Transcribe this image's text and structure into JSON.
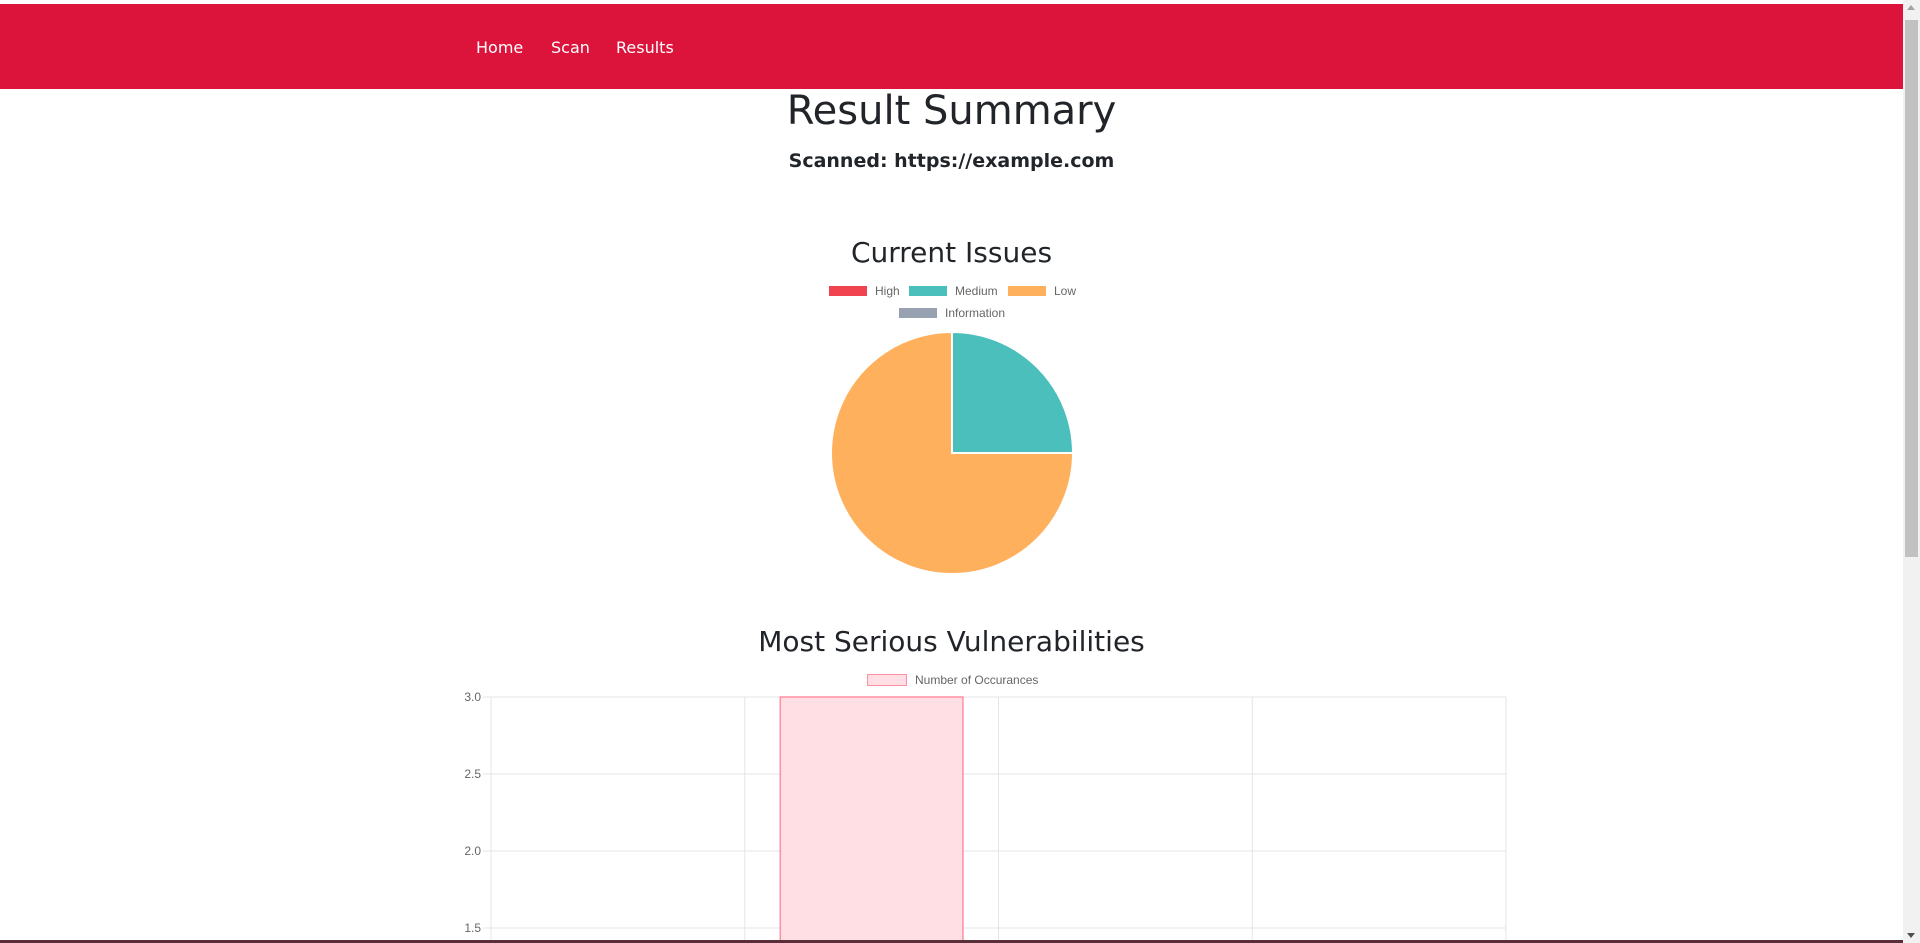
{
  "nav": {
    "items": [
      {
        "label": "Home"
      },
      {
        "label": "Scan"
      },
      {
        "label": "Results"
      }
    ],
    "background": "#dc143c"
  },
  "header": {
    "title": "Result Summary",
    "scanned": "Scanned: https://example.com"
  },
  "chart_data": [
    {
      "type": "pie",
      "title": "Current Issues",
      "categories": [
        "High",
        "Medium",
        "Low",
        "Information"
      ],
      "values": [
        0,
        1,
        3,
        0
      ],
      "colors": [
        "#f0424f",
        "#4bbfbc",
        "#ffb05c",
        "#98a1af"
      ],
      "legend": "top"
    },
    {
      "type": "bar",
      "title": "Most Serious Vulnerabilities",
      "series": [
        {
          "name": "Number of Occurances",
          "values": [
            0,
            3,
            0,
            0
          ]
        }
      ],
      "categories": [
        "",
        "",
        "",
        ""
      ],
      "ylim": [
        0,
        3.0
      ],
      "visible_yticks": [
        "3.0",
        "2.5",
        "2.0",
        "1.5"
      ],
      "bar_fill": "#ffdfe4",
      "bar_border": "#ff8fa3",
      "legend": "top",
      "grid": true
    }
  ]
}
